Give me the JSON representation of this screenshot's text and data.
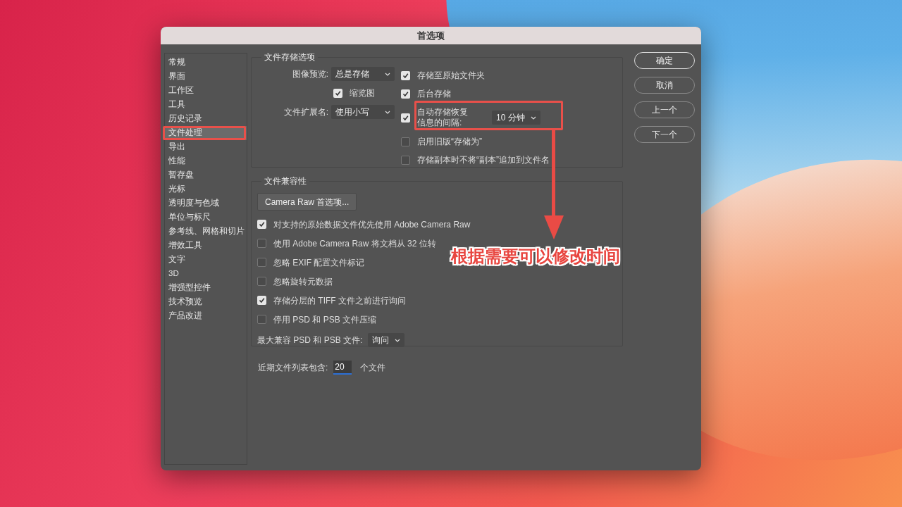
{
  "window": {
    "title": "首选项"
  },
  "sidebar": {
    "items": [
      {
        "label": "常规",
        "selected": false
      },
      {
        "label": "界面",
        "selected": false
      },
      {
        "label": "工作区",
        "selected": false
      },
      {
        "label": "工具",
        "selected": false
      },
      {
        "label": "历史记录",
        "selected": false
      },
      {
        "label": "文件处理",
        "selected": true
      },
      {
        "label": "导出",
        "selected": false
      },
      {
        "label": "性能",
        "selected": false
      },
      {
        "label": "暂存盘",
        "selected": false
      },
      {
        "label": "光标",
        "selected": false
      },
      {
        "label": "透明度与色域",
        "selected": false
      },
      {
        "label": "单位与标尺",
        "selected": false
      },
      {
        "label": "参考线、网格和切片",
        "selected": false
      },
      {
        "label": "增效工具",
        "selected": false
      },
      {
        "label": "文字",
        "selected": false
      },
      {
        "label": "3D",
        "selected": false
      },
      {
        "label": "增强型控件",
        "selected": false
      },
      {
        "label": "技术预览",
        "selected": false
      },
      {
        "label": "产品改进",
        "selected": false
      }
    ]
  },
  "file_saving": {
    "title": "文件存储选项",
    "left": [
      {
        "kind": "select",
        "label": "图像预览:",
        "value": "总是存储"
      },
      {
        "kind": "checkbox",
        "label": "缩览图",
        "checked": true
      },
      {
        "kind": "select",
        "label": "文件扩展名:",
        "value": "使用小写"
      }
    ],
    "right": [
      {
        "kind": "checkbox",
        "label": "存储至原始文件夹",
        "checked": true
      },
      {
        "kind": "checkbox",
        "label": "后台存储",
        "checked": true
      },
      {
        "kind": "checkbox_select",
        "label_lines": [
          "自动存储恢复",
          "信息的间隔:"
        ],
        "value": "10 分钟",
        "checked": true
      },
      {
        "kind": "checkbox",
        "label": "启用旧版“存储为”",
        "checked": false
      },
      {
        "kind": "checkbox",
        "label": "存储副本时不将“副本”追加到文件名",
        "checked": false
      }
    ]
  },
  "file_compat": {
    "title": "文件兼容性",
    "button": "Camera Raw 首选项...",
    "options": [
      {
        "label": "对支持的原始数据文件优先使用 Adobe Camera Raw",
        "checked": true
      },
      {
        "label": "使用 Adobe Camera Raw 将文档从 32 位转",
        "checked": false
      },
      {
        "label": "忽略 EXIF 配置文件标记",
        "checked": false
      },
      {
        "label": "忽略旋转元数据",
        "checked": false
      },
      {
        "label": "存储分层的 TIFF 文件之前进行询问",
        "checked": true
      },
      {
        "label": "停用 PSD 和 PSB 文件压缩",
        "checked": false
      }
    ],
    "max_compat": {
      "label": "最大兼容 PSD 和 PSB 文件:",
      "value": "询问"
    }
  },
  "recent_files": {
    "label": "近期文件列表包含:",
    "value": "20",
    "suffix": "个文件"
  },
  "buttons": [
    {
      "label": "确定",
      "default": true
    },
    {
      "label": "取消",
      "default": false
    },
    {
      "label": "上一个",
      "default": false
    },
    {
      "label": "下一个",
      "default": false
    }
  ],
  "annotation": {
    "callout": "根据需要可以修改时间"
  }
}
